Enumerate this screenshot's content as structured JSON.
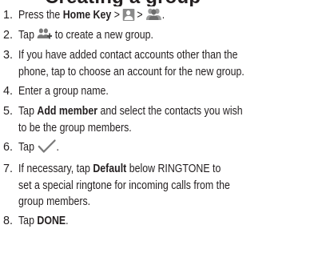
{
  "heading": "Creating a group",
  "steps": [
    {
      "num": "1.",
      "parts": [
        "Press the ",
        "Home Key",
        " > ",
        " > ",
        "."
      ],
      "icons": [
        "contacts-icon",
        "groups-icon"
      ]
    },
    {
      "num": "2.",
      "parts": [
        "Tap ",
        " to create a new group."
      ],
      "icons": [
        "add-group-icon"
      ]
    },
    {
      "num": "3.",
      "lines": [
        "If you have added contact accounts other than the",
        "phone, tap to choose an account for the new group."
      ]
    },
    {
      "num": "4.",
      "lines": [
        "Enter a group name."
      ]
    },
    {
      "num": "5.",
      "parts": [
        "Tap ",
        "Add member",
        " and select the contacts you wish"
      ],
      "line2": "to be the group members."
    },
    {
      "num": "6.",
      "parts": [
        "Tap ",
        "."
      ],
      "icons": [
        "checkmark-icon"
      ]
    },
    {
      "num": "7.",
      "parts": [
        "If necessary, tap ",
        "Default",
        " below RINGTONE to"
      ],
      "lines2": [
        "set a special ringtone for incoming calls from the",
        "group members."
      ]
    },
    {
      "num": "8.",
      "parts": [
        "Tap ",
        "DONE",
        "."
      ]
    }
  ],
  "colors": {
    "text": "#231f20",
    "icon_gray": "#8a8a8a"
  }
}
